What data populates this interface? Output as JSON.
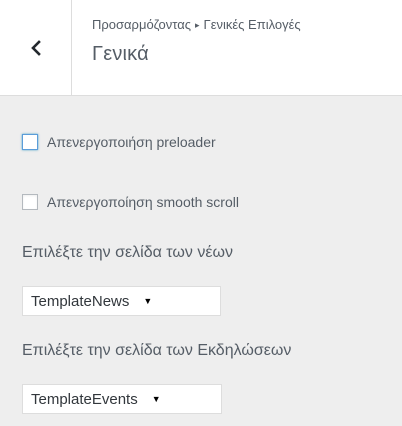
{
  "header": {
    "back_icon": "chevron-left-icon",
    "breadcrumb_root": "Προσαρμόζοντας",
    "breadcrumb_separator": "▸",
    "breadcrumb_section": "Γενικές Επιλογές",
    "title": "Γενικά"
  },
  "options": {
    "disable_preloader": {
      "label": "Απενεργοποιήση preloader",
      "checked": false
    },
    "disable_smooth_scroll": {
      "label": "Απενεργοποίηση smooth scroll",
      "checked": false
    }
  },
  "news_page": {
    "label": "Επιλέξτε την σελίδα των νέων",
    "selected": "TemplateNews"
  },
  "events_page": {
    "label": "Επιλέξτε την σελίδα των Εκδηλώσεων",
    "selected": "TemplateEvents"
  },
  "dropdown_arrow": "▼",
  "colors": {
    "panel_background": "#eeeeee",
    "header_background": "#ffffff",
    "text": "#555d66",
    "focus_border": "#5b9dd9"
  }
}
